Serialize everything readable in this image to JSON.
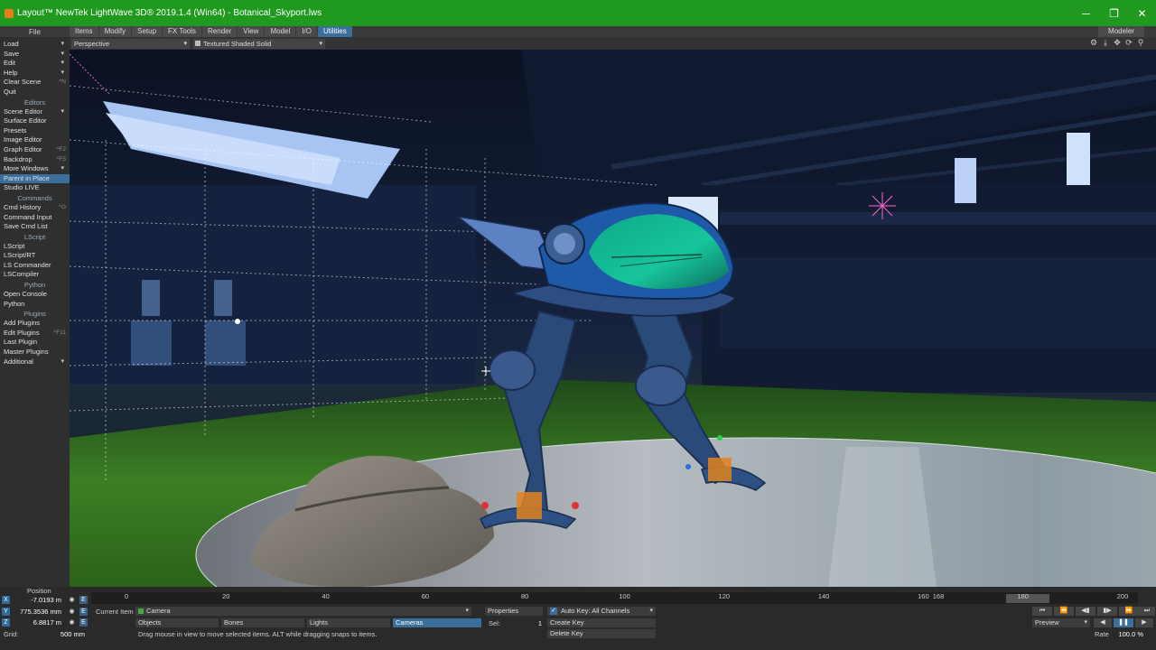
{
  "window": {
    "title": "Layout™ NewTek LightWave 3D® 2019.1.4 (Win64) - Botanical_Skyport.lws",
    "minimize": "─",
    "maximize": "❐",
    "close": "✕"
  },
  "menu": {
    "file": "File",
    "tabs": [
      "Items",
      "Modify",
      "Setup",
      "FX Tools",
      "Render",
      "View",
      "Model",
      "I/O",
      "Utilities"
    ],
    "modeler": "Modeler"
  },
  "viewport_header": {
    "view_mode": "Perspective",
    "shading": "Textured Shaded Solid",
    "icons": [
      "gear-icon",
      "download-icon",
      "move-icon",
      "rotate-icon",
      "zoom-icon"
    ]
  },
  "leftbar": {
    "sections": [
      {
        "header": "",
        "items": [
          {
            "label": "Load",
            "dd": true
          },
          {
            "label": "Save",
            "dd": true
          },
          {
            "label": "Edit",
            "dd": true
          },
          {
            "label": "Help",
            "dd": true
          },
          {
            "label": "Clear Scene",
            "sc": "^N"
          },
          {
            "label": "Quit"
          }
        ]
      },
      {
        "header": "Editors",
        "items": [
          {
            "label": "Scene Editor",
            "dd": true
          },
          {
            "label": "Surface Editor"
          },
          {
            "label": "Presets"
          },
          {
            "label": "Image Editor"
          },
          {
            "label": "Graph Editor",
            "sc": "^F2"
          },
          {
            "label": "Backdrop",
            "sc": "^F5"
          },
          {
            "label": "More Windows",
            "dd": true
          },
          {
            "label": "Parent in Place",
            "hl": true
          },
          {
            "label": "Studio LIVE"
          }
        ]
      },
      {
        "header": "Commands",
        "items": [
          {
            "label": "Cmd History",
            "sc": "^G"
          },
          {
            "label": "Command Input"
          },
          {
            "label": "Save Cmd List"
          }
        ]
      },
      {
        "header": "LScript",
        "items": [
          {
            "label": "LScript"
          },
          {
            "label": "LScript/RT"
          },
          {
            "label": "LS Commander"
          },
          {
            "label": "LSCompiler"
          }
        ]
      },
      {
        "header": "Python",
        "items": [
          {
            "label": "Open Console"
          },
          {
            "label": "Python"
          }
        ]
      },
      {
        "header": "Plugins",
        "items": [
          {
            "label": "Add Plugins"
          },
          {
            "label": "Edit Plugins",
            "sc": "^F11"
          },
          {
            "label": "Last Plugin"
          },
          {
            "label": "Master Plugins"
          },
          {
            "label": "Additional",
            "dd": true
          }
        ]
      }
    ]
  },
  "timeline": {
    "position_label": "Position",
    "x_label": "X",
    "y_label": "Y",
    "z_label": "Z",
    "x_value": "-7.0193 m",
    "y_value": "775.3536 mm",
    "z_value": "6.8817 m",
    "grid_label": "Grid:",
    "grid_value": "500 mm",
    "ticks": [
      "0",
      "20",
      "40",
      "60",
      "80",
      "100",
      "120",
      "140",
      "160",
      "180",
      "200"
    ],
    "start_frame": "0",
    "current_frame": "168",
    "end_frame": "200",
    "current_item_label": "Current Item",
    "current_item": "Camera",
    "item_types": [
      "Objects",
      "Bones",
      "Lights",
      "Cameras"
    ],
    "properties": "Properties",
    "sel_label": "Sel:",
    "sel_value": "1",
    "auto_key": "Auto Key: All Channels",
    "create_key": "Create Key",
    "delete_key": "Delete Key",
    "status": "Drag mouse in view to move selected items. ALT while dragging snaps to items.",
    "preview": "Preview",
    "rate_label": "Rate",
    "rate_value": "100.0 %",
    "e_label": "E"
  }
}
